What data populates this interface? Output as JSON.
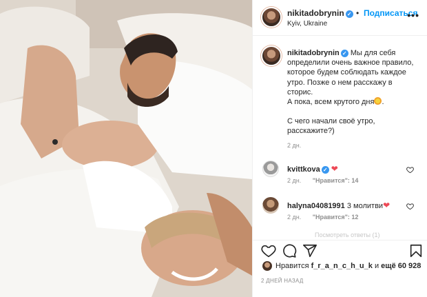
{
  "post": {
    "author": "nikitadobrynin",
    "location": "Kyiv, Ukraine",
    "follow_label": "Подписаться",
    "dot": "•",
    "more_label": "•••",
    "verified_mark": "✓"
  },
  "caption": {
    "username": "nikitadobrynin",
    "lines": [
      "Мы для себя определили очень важное правило, которое будем соблюдать каждое утро. Позже о нем расскажу в сторис.",
      "А пока, всем крутого дня",
      "С чего начали своё утро, расскажите?)"
    ],
    "trailing": ".",
    "time": "2 дн."
  },
  "comments": [
    {
      "username": "kvittkova",
      "text": "",
      "heart": "❤",
      "time": "2 дн.",
      "likes": "\"Нравится\": 14"
    },
    {
      "username": "halyna04081991",
      "text": "3 молитви",
      "heart": "❤",
      "time": "2 дн.",
      "likes": "\"Нравится\": 12"
    }
  ],
  "faded_text": "Посмотреть ответы (1)",
  "likes": {
    "prefix": "Нравится",
    "user": "f_r_a_n_c_h_u_k",
    "middle": "и",
    "rest": "ещё 60 928"
  },
  "post_date": "2 ДНЕЙ НАЗАД",
  "colors": {
    "accent": "#0095f6",
    "heart": "#ed4956",
    "verified": "#3897f0",
    "muted": "#8e8e8e"
  },
  "icons": [
    "heart-icon",
    "comment-icon",
    "share-icon",
    "bookmark-icon",
    "more-icon",
    "verified-icon"
  ]
}
